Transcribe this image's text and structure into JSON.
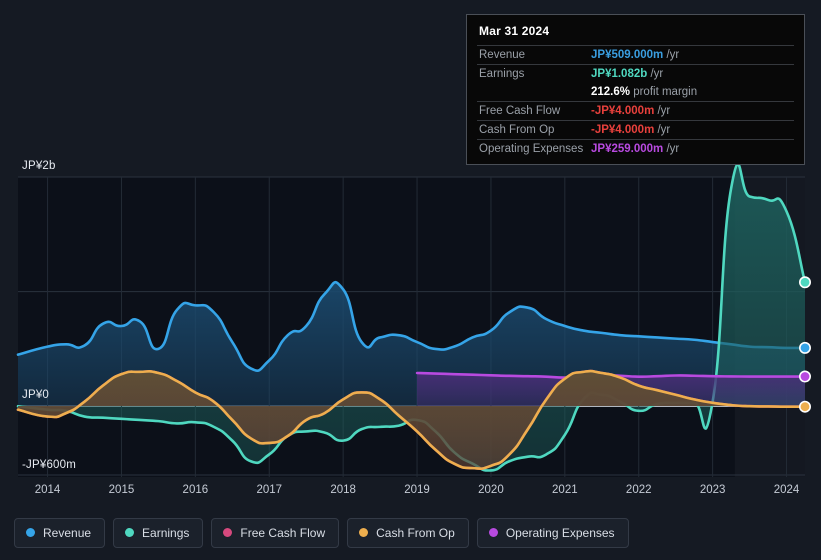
{
  "chart_data": {
    "type": "area",
    "title": "",
    "xlabel": "",
    "ylabel": "",
    "currency": "JP¥",
    "grid": true,
    "legend_position": "bottom",
    "x": [
      2013.6,
      2014,
      2014.25,
      2014.5,
      2014.75,
      2015,
      2015.25,
      2015.5,
      2015.75,
      2016,
      2016.25,
      2016.5,
      2016.75,
      2017,
      2017.25,
      2017.5,
      2017.75,
      2018,
      2018.25,
      2018.5,
      2018.75,
      2019,
      2019.25,
      2019.5,
      2019.75,
      2020,
      2020.25,
      2020.5,
      2020.75,
      2021,
      2021.25,
      2021.5,
      2021.75,
      2022,
      2022.25,
      2022.5,
      2022.75,
      2023,
      2023.25,
      2023.5,
      2023.75,
      2024,
      2024.25
    ],
    "x_ticks": [
      "2014",
      "2015",
      "2016",
      "2017",
      "2018",
      "2019",
      "2020",
      "2021",
      "2022",
      "2023",
      "2024"
    ],
    "y_ticks": [
      "JP¥2b",
      "JP¥0",
      "-JP¥600m"
    ],
    "ylim": [
      -600,
      2000
    ],
    "gridlines": [
      2000,
      1000,
      0,
      -600
    ],
    "series": [
      {
        "name": "Revenue",
        "color": "#35a4e8",
        "fill": "#1b4a6e",
        "values": [
          450,
          520,
          540,
          530,
          720,
          700,
          740,
          500,
          840,
          880,
          820,
          560,
          330,
          400,
          620,
          700,
          980,
          1020,
          560,
          600,
          620,
          560,
          500,
          520,
          600,
          660,
          820,
          860,
          760,
          700,
          660,
          640,
          620,
          610,
          600,
          590,
          580,
          560,
          540,
          520,
          515,
          509,
          509
        ]
      },
      {
        "name": "Earnings",
        "color": "#4fd8c0",
        "fill": "#1d5f5c",
        "values": [
          0,
          -30,
          -40,
          -90,
          -100,
          -110,
          -120,
          -130,
          -150,
          -140,
          -180,
          -300,
          -480,
          -420,
          -260,
          -220,
          -230,
          -300,
          -200,
          -180,
          -170,
          -120,
          -220,
          -400,
          -500,
          -560,
          -480,
          -440,
          -420,
          -250,
          60,
          100,
          40,
          -40,
          20,
          30,
          30,
          40,
          1900,
          1830,
          1800,
          1700,
          1082
        ]
      },
      {
        "name": "Free Cash Flow",
        "color": "#d6497e",
        "fill": "#5c2030",
        "values": [
          -30,
          -90,
          -60,
          40,
          180,
          280,
          300,
          290,
          220,
          120,
          40,
          -120,
          -280,
          -320,
          -260,
          -120,
          -60,
          60,
          120,
          60,
          -80,
          -220,
          -380,
          -500,
          -540,
          -520,
          -420,
          -200,
          60,
          240,
          300,
          290,
          250,
          180,
          140,
          100,
          60,
          30,
          10,
          0,
          -2,
          -4,
          -4
        ]
      },
      {
        "name": "Cash From Op",
        "color": "#eeae4e",
        "fill": "#5f5336",
        "values": [
          -30,
          -90,
          -60,
          40,
          180,
          280,
          300,
          290,
          220,
          120,
          40,
          -120,
          -280,
          -320,
          -260,
          -120,
          -60,
          60,
          120,
          60,
          -80,
          -220,
          -380,
          -500,
          -540,
          -520,
          -420,
          -200,
          60,
          240,
          300,
          290,
          250,
          180,
          140,
          100,
          60,
          30,
          10,
          0,
          -2,
          -4,
          -4
        ]
      },
      {
        "name": "Operating Expenses",
        "color": "#b84ae0",
        "fill": "#4a2e78",
        "start_index": 21,
        "values": [
          null,
          null,
          null,
          null,
          null,
          null,
          null,
          null,
          null,
          null,
          null,
          null,
          null,
          null,
          null,
          null,
          null,
          null,
          null,
          null,
          null,
          290,
          285,
          280,
          275,
          270,
          265,
          262,
          258,
          250,
          262,
          270,
          266,
          258,
          262,
          268,
          266,
          262,
          260,
          259,
          259,
          259,
          259
        ]
      }
    ],
    "highlight_band": {
      "from": 2023.3,
      "to": 2024.25
    }
  },
  "tooltip": {
    "date": "Mar 31 2024",
    "rows": [
      {
        "key": "Revenue",
        "value": "JP¥509.000m",
        "unit": "/yr",
        "color": "#3a9ee0"
      },
      {
        "key": "Earnings",
        "value": "JP¥1.082b",
        "unit": "/yr",
        "color": "#4fd8c0"
      },
      {
        "key": "",
        "value": "212.6%",
        "unit": "profit margin",
        "color": "#ffffff"
      },
      {
        "key": "Free Cash Flow",
        "value": "-JP¥4.000m",
        "unit": "/yr",
        "color": "#e8403c"
      },
      {
        "key": "Cash From Op",
        "value": "-JP¥4.000m",
        "unit": "/yr",
        "color": "#e8403c"
      },
      {
        "key": "Operating Expenses",
        "value": "JP¥259.000m",
        "unit": "/yr",
        "color": "#b84ae0"
      }
    ]
  },
  "legend": {
    "items": [
      {
        "label": "Revenue",
        "color": "#35a4e8"
      },
      {
        "label": "Earnings",
        "color": "#4fd8c0"
      },
      {
        "label": "Free Cash Flow",
        "color": "#d6497e"
      },
      {
        "label": "Cash From Op",
        "color": "#eeae4e"
      },
      {
        "label": "Operating Expenses",
        "color": "#b84ae0"
      }
    ]
  },
  "axis": {
    "y_top": "JP¥2b",
    "y_zero": "JP¥0",
    "y_bottom": "-JP¥600m"
  }
}
